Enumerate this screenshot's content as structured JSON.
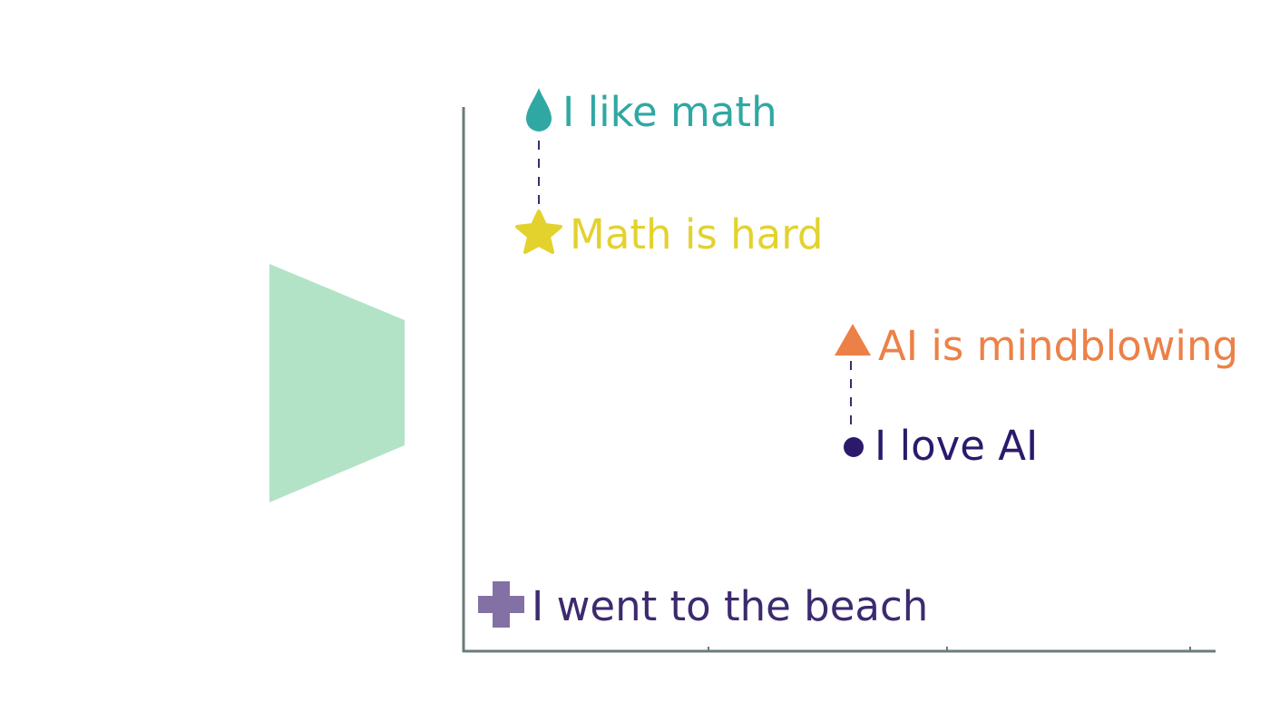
{
  "colors": {
    "axis": "#6b7b7b",
    "encoder_shape": "#b2e3c6",
    "connector": "#3a2d6e",
    "teal": "#2fa8a3",
    "yellow": "#e3d22e",
    "orange": "#ec8148",
    "indigo": "#2b1a6b",
    "purple": "#3d2a6e",
    "purple_marker": "#8371a6"
  },
  "points": [
    {
      "id": "like-math",
      "label": "I like math",
      "marker": "drop-icon",
      "color": "#2fa8a3"
    },
    {
      "id": "math-hard",
      "label": "Math is hard",
      "marker": "star-icon",
      "color": "#e3d22e"
    },
    {
      "id": "ai-mindblowing",
      "label": "AI is mindblowing",
      "marker": "triangle-icon",
      "color": "#ec8148"
    },
    {
      "id": "love-ai",
      "label": "I love AI",
      "marker": "circle-icon",
      "color": "#2b1a6b"
    },
    {
      "id": "beach",
      "label": "I went to the beach",
      "marker": "plus-icon",
      "color": "#3d2a6e",
      "marker_color": "#8371a6"
    }
  ]
}
